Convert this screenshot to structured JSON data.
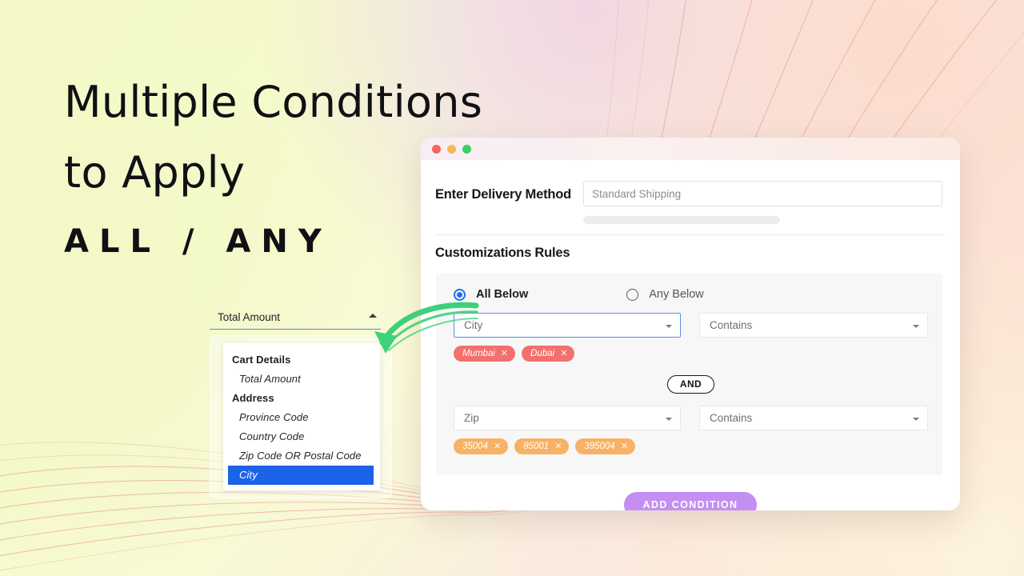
{
  "background": {
    "accent_yellow": "#f4f9c6",
    "accent_peach": "#fadfd2",
    "accent_lilac": "#ecd4ee",
    "swirl_color": "#e8938f"
  },
  "headline": {
    "line1": "Multiple Conditions",
    "line2": "to Apply",
    "line3": "ALL / ANY"
  },
  "field_dropdown": {
    "selected_value": "Total Amount",
    "caret_icon": "chevron-up-icon",
    "groups": [
      {
        "label": "Cart Details",
        "options": [
          {
            "label": "Total Amount",
            "selected": false
          }
        ]
      },
      {
        "label": "Address",
        "options": [
          {
            "label": "Province Code",
            "selected": false
          },
          {
            "label": "Country Code",
            "selected": false
          },
          {
            "label": "Zip Code OR Postal Code",
            "selected": false
          },
          {
            "label": "City",
            "selected": true
          }
        ]
      }
    ],
    "highlight_color": "#1b63e8"
  },
  "arrow": {
    "icon": "curved-arrow-icon",
    "color": "#3fd07a"
  },
  "app_window": {
    "traffic_lights": [
      {
        "name": "close-dot",
        "color": "#f4645f"
      },
      {
        "name": "minimize-dot",
        "color": "#f6b756"
      },
      {
        "name": "maximize-dot",
        "color": "#3ecf60"
      }
    ],
    "delivery": {
      "label": "Enter Delivery Method",
      "input_value": "",
      "input_placeholder": "Standard Shipping"
    },
    "rules": {
      "title": "Customizations Rules",
      "match_mode": [
        {
          "id": "all",
          "label": "All Below",
          "selected": true
        },
        {
          "id": "any",
          "label": "Any Below",
          "selected": false
        }
      ],
      "conditions": [
        {
          "field": "City",
          "field_focused": true,
          "operator": "Contains",
          "tag_color": "#f2706e",
          "tag_style": "red",
          "values": [
            "Mumbai",
            "Dubai"
          ]
        },
        {
          "field": "Zip",
          "field_focused": false,
          "operator": "Contains",
          "tag_color": "#f8b265",
          "tag_style": "orange",
          "values": [
            "35004",
            "85001",
            "395004"
          ]
        }
      ],
      "joiner": "AND",
      "add_button": "ADD CONDITION",
      "add_button_color": "#c48ef2",
      "caret_icon": "chevron-down-icon",
      "remove_icon": "close-x-icon"
    }
  }
}
